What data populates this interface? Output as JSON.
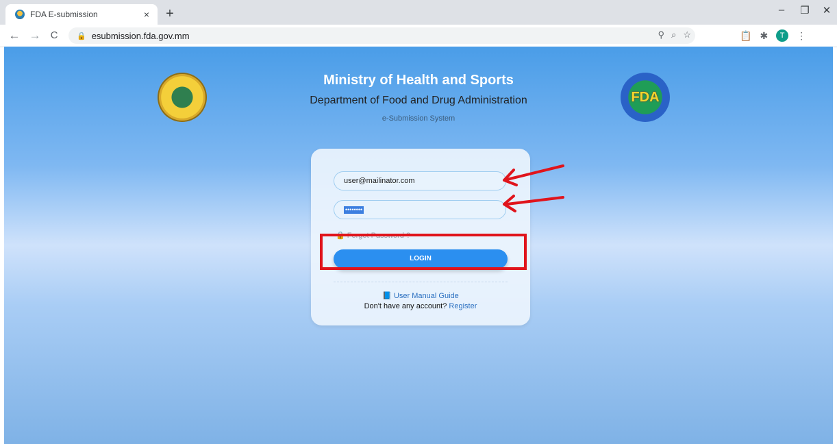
{
  "browser": {
    "tab_title": "FDA E-submission",
    "tab_close": "×",
    "new_tab": "+",
    "url": "esubmission.fda.gov.mm",
    "back": "←",
    "forward": "→",
    "reload": "C",
    "minimize": "–",
    "restore": "❐",
    "close": "✕",
    "avatar_letter": "T",
    "icons": [
      "key-icon",
      "zoom-icon",
      "star-icon",
      "clipboard-icon",
      "extensions-icon",
      "menu-icon"
    ]
  },
  "header": {
    "title": "Ministry of Health and Sports",
    "subtitle": "Department of Food and Drug Administration",
    "system": "e-Submission System",
    "right_logo_text": "FDA"
  },
  "login": {
    "email_value": "user@mailinator.com",
    "password_dots": "••••••••",
    "forgot_label": "Forgot Password ?",
    "login_label": "LOGIN",
    "manual_label": "User Manual Guide",
    "no_account_text": "Don't have any account?",
    "register_label": "Register"
  },
  "annotations": {
    "color": "#e0141c"
  }
}
